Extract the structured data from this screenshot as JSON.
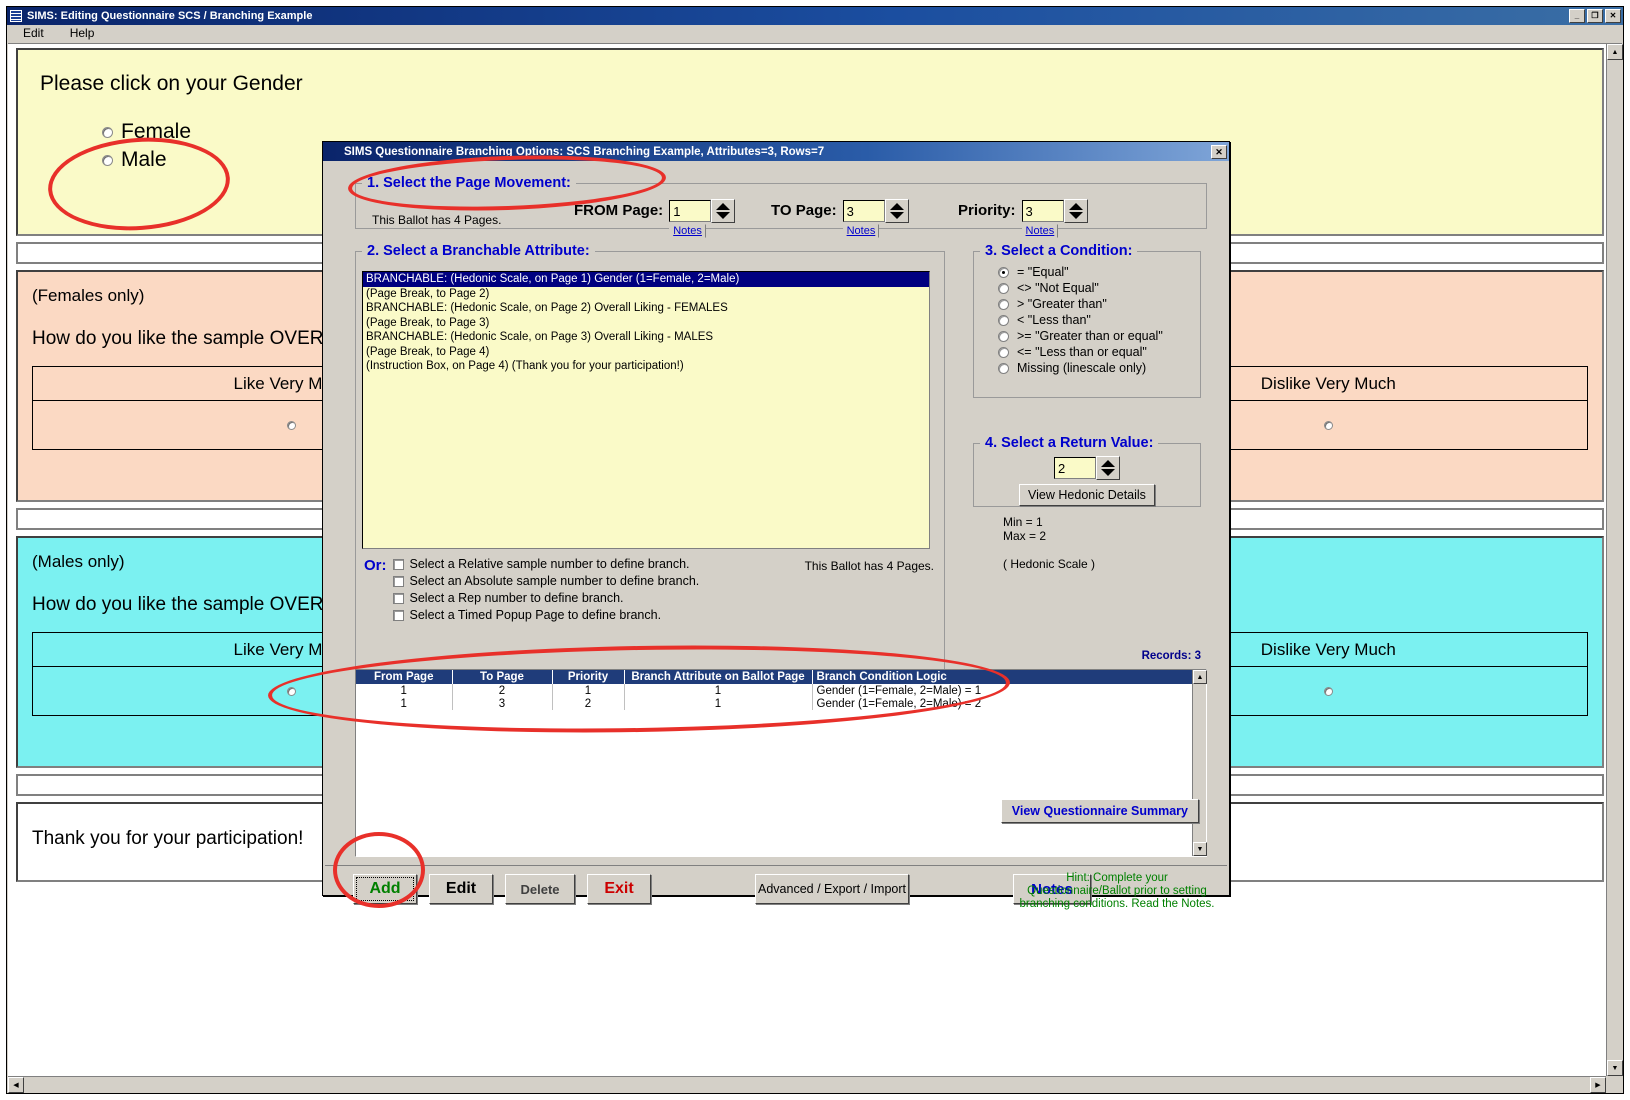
{
  "app": {
    "title": "SIMS: Editing Questionnaire SCS / Branching Example",
    "menu": [
      "Edit",
      "Help"
    ],
    "window_buttons": [
      "_",
      "❐",
      "✕"
    ]
  },
  "ballot": {
    "page1": {
      "question": "Please click on your Gender",
      "options": [
        "Female",
        "Male"
      ]
    },
    "page2": {
      "note": "(Females only)",
      "question": "How do you like the sample OVERALL?",
      "scale_left": "Like Very Much",
      "scale_right": "Dislike Very Much"
    },
    "page3": {
      "note": "(Males only)",
      "question": "How do you like the sample OVERALL?",
      "scale_left": "Like Very Much",
      "scale_right": "Dislike Very Much"
    },
    "page4": {
      "message": "Thank you for your participation!"
    }
  },
  "dialog": {
    "title": "SIMS   Questionnaire Branching Options:  SCS  Branching Example, Attributes=3, Rows=7",
    "close_label": "✕",
    "step1": {
      "legend": "1.  Select the Page Movement:",
      "ballot_pages_note": "This Ballot has 4 Pages.",
      "fields": [
        {
          "label": "FROM Page:",
          "value": "1",
          "notes_label": "Notes"
        },
        {
          "label": "TO Page:",
          "value": "3",
          "notes_label": "Notes"
        },
        {
          "label": "Priority:",
          "value": "3",
          "notes_label": "Notes"
        }
      ]
    },
    "step2": {
      "legend": "2.  Select a Branchable Attribute:",
      "items": [
        {
          "text": "BRANCHABLE:  (Hedonic Scale, on Page 1)  Gender (1=Female, 2=Male)",
          "selected": true
        },
        {
          "text": "(Page Break, to Page 2)",
          "selected": false
        },
        {
          "text": "BRANCHABLE:  (Hedonic Scale, on Page 2)  Overall Liking - FEMALES",
          "selected": false
        },
        {
          "text": "(Page Break, to Page 3)",
          "selected": false
        },
        {
          "text": "BRANCHABLE:  (Hedonic Scale, on Page 3)  Overall Liking - MALES",
          "selected": false
        },
        {
          "text": "(Page Break, to Page 4)",
          "selected": false
        },
        {
          "text": "(Instruction Box, on Page 4)  (Thank you for your participation!)",
          "selected": false
        }
      ],
      "or_label": "Or:",
      "checkboxes": [
        {
          "label": "Select a Relative sample number to define branch.",
          "checked": false
        },
        {
          "label": "Select an Absolute sample number to define branch.",
          "checked": false
        },
        {
          "label": "Select a Rep number to define branch.",
          "checked": false
        },
        {
          "label": "Select a Timed Popup Page to define branch.",
          "checked": false
        }
      ],
      "ballot_pages_note": "This Ballot has 4 Pages."
    },
    "step3": {
      "legend": "3.  Select a Condition:",
      "options": [
        {
          "label": "=  \"Equal\"",
          "selected": true
        },
        {
          "label": "<> \"Not Equal\"",
          "selected": false
        },
        {
          "label": ">  \"Greater than\"",
          "selected": false
        },
        {
          "label": "<  \"Less than\"",
          "selected": false
        },
        {
          "label": ">= \"Greater than or equal\"",
          "selected": false
        },
        {
          "label": "<= \"Less than or equal\"",
          "selected": false
        },
        {
          "label": "Missing (linescale only)",
          "selected": false
        }
      ]
    },
    "step4": {
      "legend": "4. Select a Return Value:",
      "value": "2",
      "details_button": "View Hedonic Details",
      "min_text": "Min  = 1",
      "max_text": "Max = 2",
      "scale_text": "( Hedonic Scale )"
    },
    "records_label": "Records: 3",
    "grid": {
      "columns": [
        "From Page",
        "To Page",
        "Priority",
        "Branch Attribute on Ballot Page",
        "Branch Condition Logic"
      ],
      "rows": [
        [
          "1",
          "2",
          "1",
          "1",
          "Gender (1=Female, 2=Male) = 1"
        ],
        [
          "1",
          "3",
          "2",
          "1",
          "Gender (1=Female, 2=Male) = 2"
        ]
      ]
    },
    "summary_button": "View Questionnaire Summary",
    "buttons": [
      {
        "label": "Add",
        "color": "#008000",
        "focused": true
      },
      {
        "label": "Edit",
        "color": "#000000",
        "focused": false
      },
      {
        "label": "Delete",
        "color": "#404040",
        "focused": false
      },
      {
        "label": "Exit",
        "color": "#cc0000",
        "focused": false
      }
    ],
    "advanced_button": "Advanced / Export / Import",
    "notes_button": "Notes",
    "hint": "Hint: Complete your Questionnaire/Ballot prior to setting branching conditions. Read the Notes."
  }
}
